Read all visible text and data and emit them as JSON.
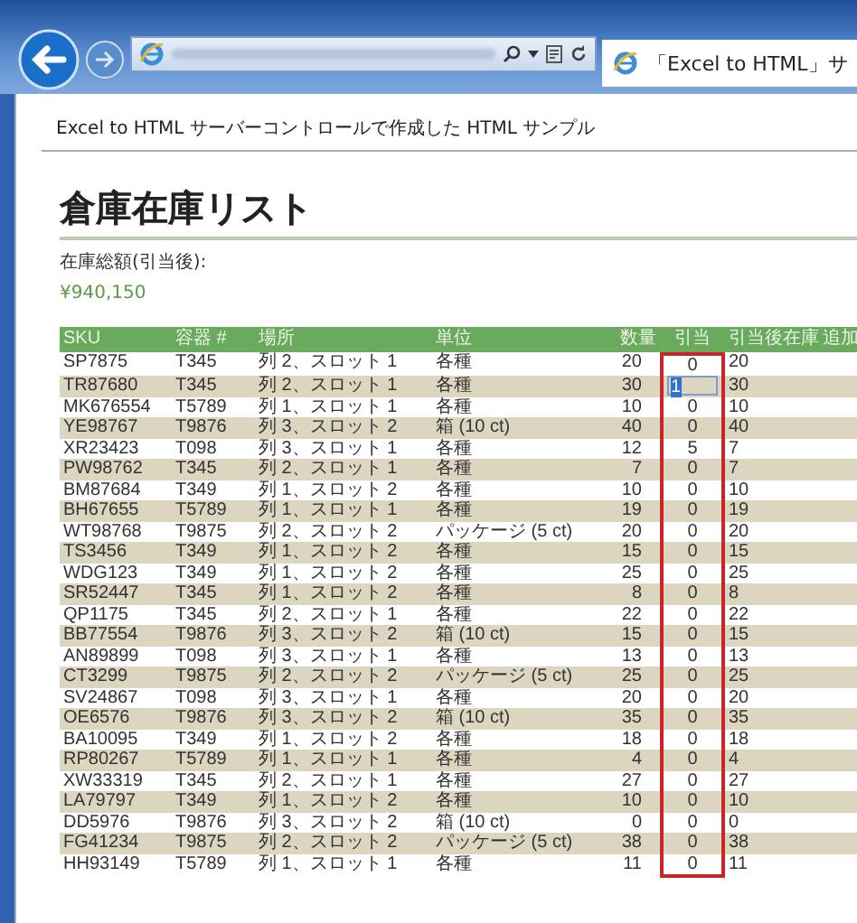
{
  "browser": {
    "tab_title": "「Excel to HTML」サ"
  },
  "page": {
    "header": "Excel to HTML サーバーコントロールで作成した HTML サンプル",
    "title": "倉庫在庫リスト",
    "total_label": "在庫総額(引当後):",
    "total_value": "¥940,150"
  },
  "table": {
    "columns": [
      {
        "label": "SKU",
        "highlighted": false
      },
      {
        "label": "容器 #",
        "highlighted": false
      },
      {
        "label": "場所",
        "highlighted": false
      },
      {
        "label": "単位",
        "highlighted": false
      },
      {
        "label": "数量",
        "highlighted": false
      },
      {
        "label": "引当",
        "highlighted": true
      },
      {
        "label": "引当後在庫",
        "highlighted": false
      },
      {
        "label": "追加",
        "highlighted": false
      }
    ],
    "rows": [
      {
        "kind": "plain",
        "cells": [
          "SP7875",
          "T345",
          "列 2、スロット 1",
          "各種",
          "20",
          "0",
          "20"
        ]
      },
      {
        "kind": "editing",
        "cells": [
          "TR87680",
          "T345",
          "列 2、スロット 1",
          "各種",
          "30",
          "1",
          "30"
        ]
      },
      {
        "kind": "plain",
        "cells": [
          "MK676554",
          "T5789",
          "列 1、スロット 1",
          "各種",
          "10",
          "0",
          "10"
        ]
      },
      {
        "kind": "plain",
        "cells": [
          "YE98767",
          "T9876",
          "列 3、スロット 2",
          "箱 (10 ct)",
          "40",
          "0",
          "40"
        ]
      },
      {
        "kind": "plain",
        "cells": [
          "XR23423",
          "T098",
          "列 3、スロット 1",
          "各種",
          "12",
          "5",
          "7"
        ]
      },
      {
        "kind": "plain",
        "cells": [
          "PW98762",
          "T345",
          "列 2、スロット 1",
          "各種",
          "7",
          "0",
          "7"
        ]
      },
      {
        "kind": "plain",
        "cells": [
          "BM87684",
          "T349",
          "列 1、スロット 2",
          "各種",
          "10",
          "0",
          "10"
        ]
      },
      {
        "kind": "plain",
        "cells": [
          "BH67655",
          "T5789",
          "列 1、スロット 1",
          "各種",
          "19",
          "0",
          "19"
        ]
      },
      {
        "kind": "plain",
        "cells": [
          "WT98768",
          "T9875",
          "列 2、スロット 2",
          "パッケージ (5 ct)",
          "20",
          "0",
          "20"
        ]
      },
      {
        "kind": "plain",
        "cells": [
          "TS3456",
          "T349",
          "列 1、スロット 2",
          "各種",
          "15",
          "0",
          "15"
        ]
      },
      {
        "kind": "plain",
        "cells": [
          "WDG123",
          "T349",
          "列 1、スロット 2",
          "各種",
          "25",
          "0",
          "25"
        ]
      },
      {
        "kind": "plain",
        "cells": [
          "SR52447",
          "T345",
          "列 1、スロット 2",
          "各種",
          "8",
          "0",
          "8"
        ]
      },
      {
        "kind": "plain",
        "cells": [
          "QP1175",
          "T345",
          "列 2、スロット 1",
          "各種",
          "22",
          "0",
          "22"
        ]
      },
      {
        "kind": "plain",
        "cells": [
          "BB77554",
          "T9876",
          "列 3、スロット 2",
          "箱 (10 ct)",
          "15",
          "0",
          "15"
        ]
      },
      {
        "kind": "plain",
        "cells": [
          "AN89899",
          "T098",
          "列 3、スロット 1",
          "各種",
          "13",
          "0",
          "13"
        ]
      },
      {
        "kind": "plain",
        "cells": [
          "CT3299",
          "T9875",
          "列 2、スロット 2",
          "パッケージ (5 ct)",
          "25",
          "0",
          "25"
        ]
      },
      {
        "kind": "plain",
        "cells": [
          "SV24867",
          "T098",
          "列 3、スロット 1",
          "各種",
          "20",
          "0",
          "20"
        ]
      },
      {
        "kind": "plain",
        "cells": [
          "OE6576",
          "T9876",
          "列 3、スロット 2",
          "箱 (10 ct)",
          "35",
          "0",
          "35"
        ]
      },
      {
        "kind": "plain",
        "cells": [
          "BA10095",
          "T349",
          "列 1、スロット 2",
          "各種",
          "18",
          "0",
          "18"
        ]
      },
      {
        "kind": "plain",
        "cells": [
          "RP80267",
          "T5789",
          "列 1、スロット 1",
          "各種",
          "4",
          "0",
          "4"
        ]
      },
      {
        "kind": "plain",
        "cells": [
          "XW33319",
          "T345",
          "列 2、スロット 1",
          "各種",
          "27",
          "0",
          "27"
        ]
      },
      {
        "kind": "plain",
        "cells": [
          "LA79797",
          "T349",
          "列 1、スロット 2",
          "各種",
          "10",
          "0",
          "10"
        ]
      },
      {
        "kind": "plain",
        "cells": [
          "DD5976",
          "T9876",
          "列 3、スロット 2",
          "箱 (10 ct)",
          "0",
          "0",
          "0"
        ]
      },
      {
        "kind": "plain",
        "cells": [
          "FG41234",
          "T9875",
          "列 2、スロット 2",
          "パッケージ (5 ct)",
          "38",
          "0",
          "38"
        ]
      },
      {
        "kind": "plain",
        "cells": [
          "HH93149",
          "T5789",
          "列 1、スロット 1",
          "各種",
          "11",
          "0",
          "11"
        ]
      }
    ]
  }
}
